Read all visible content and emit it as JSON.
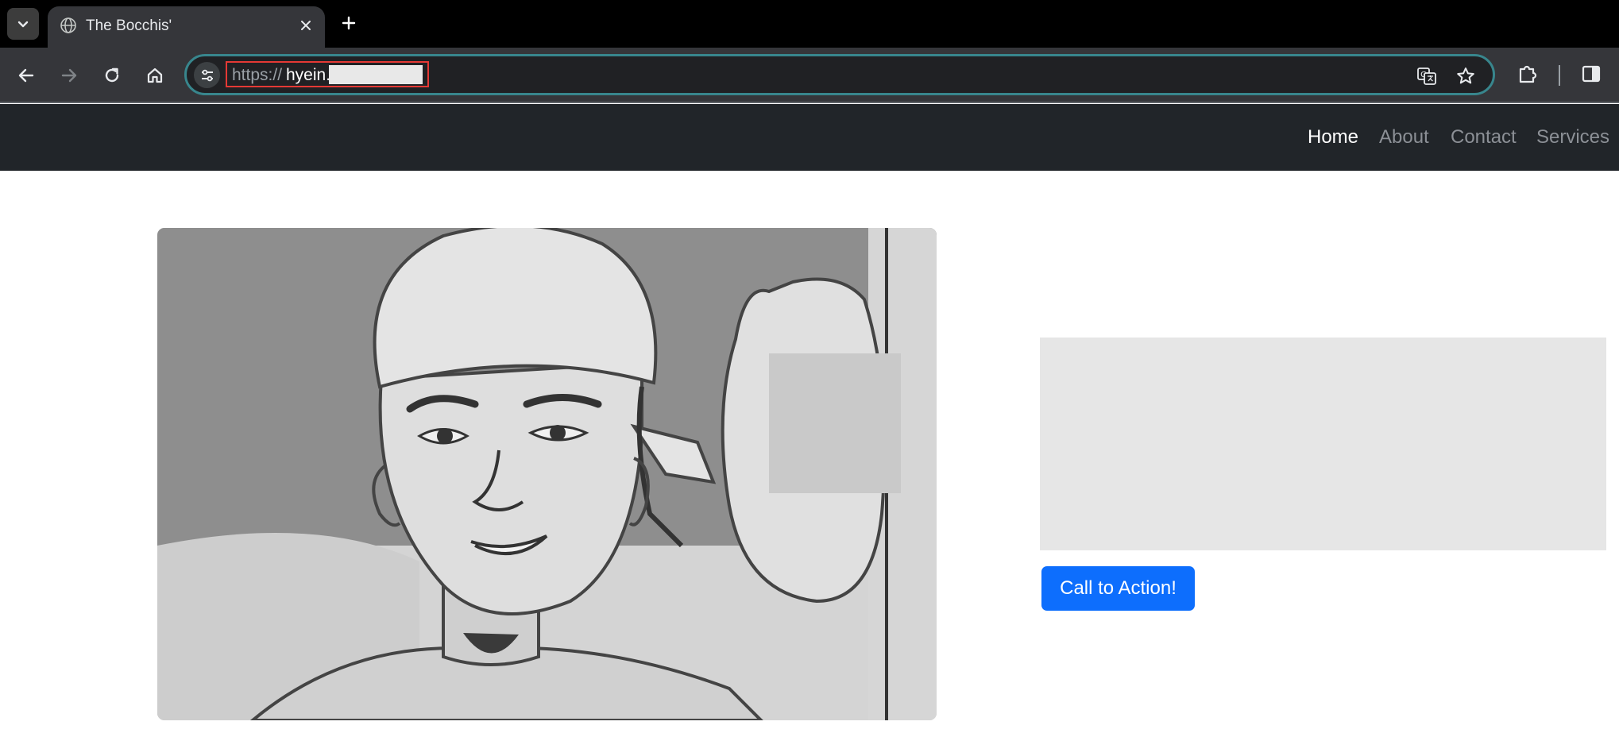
{
  "browser": {
    "tab_title": "The Bocchis'",
    "url_scheme": "https://",
    "url_host": "hyein."
  },
  "site_nav": {
    "links": [
      {
        "label": "Home",
        "active": true
      },
      {
        "label": "About",
        "active": false
      },
      {
        "label": "Contact",
        "active": false
      },
      {
        "label": "Services",
        "active": false
      }
    ]
  },
  "hero": {
    "cta_label": "Call to Action!"
  },
  "colors": {
    "navbar_bg": "#212529",
    "cta_bg": "#0d6efd",
    "omnibox_border": "#38868d"
  }
}
